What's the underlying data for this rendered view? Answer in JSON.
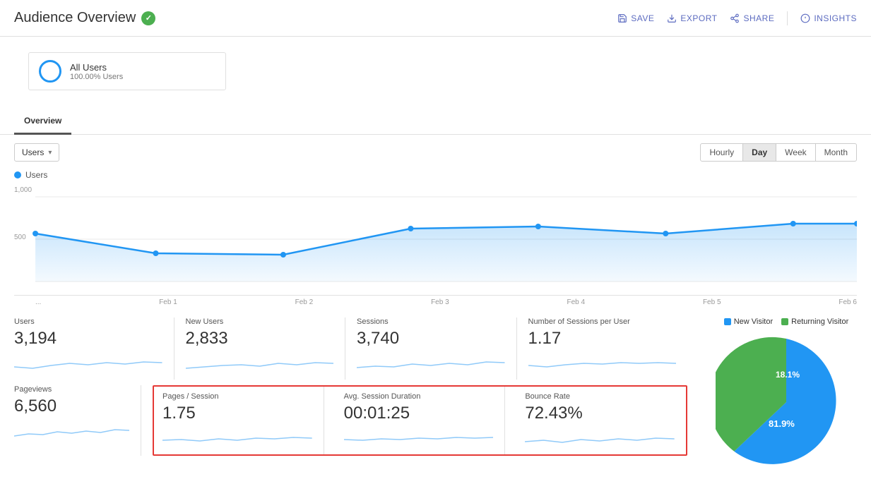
{
  "header": {
    "title": "Audience Overview",
    "actions": [
      {
        "label": "SAVE",
        "icon": "save-icon"
      },
      {
        "label": "EXPORT",
        "icon": "export-icon"
      },
      {
        "label": "SHARE",
        "icon": "share-icon"
      },
      {
        "label": "INSIGHTS",
        "icon": "insights-icon"
      }
    ]
  },
  "segment": {
    "name": "All Users",
    "sub": "100.00% Users"
  },
  "tabs": [
    {
      "label": "Overview",
      "active": true
    }
  ],
  "chart": {
    "metric_dropdown": "Users",
    "legend_label": "Users",
    "y_labels": [
      "1,000",
      "500"
    ],
    "x_labels": [
      "...",
      "Feb 1",
      "Feb 2",
      "Feb 3",
      "Feb 4",
      "Feb 5",
      "Feb 6"
    ],
    "time_buttons": [
      {
        "label": "Hourly",
        "active": false
      },
      {
        "label": "Day",
        "active": true
      },
      {
        "label": "Week",
        "active": false
      },
      {
        "label": "Month",
        "active": false
      }
    ]
  },
  "metrics": {
    "row1": [
      {
        "label": "Users",
        "value": "3,194",
        "highlight": false
      },
      {
        "label": "New Users",
        "value": "2,833",
        "highlight": false
      },
      {
        "label": "Sessions",
        "value": "3,740",
        "highlight": false
      },
      {
        "label": "Number of Sessions per User",
        "value": "1.17",
        "highlight": false
      }
    ],
    "pageviews": {
      "label": "Pageviews",
      "value": "6,560"
    },
    "row2": [
      {
        "label": "Pages / Session",
        "value": "1.75",
        "highlight": true
      },
      {
        "label": "Avg. Session Duration",
        "value": "00:01:25",
        "highlight": true
      },
      {
        "label": "Bounce Rate",
        "value": "72.43%",
        "highlight": true
      }
    ]
  },
  "pie": {
    "new_visitor_pct": 81.9,
    "returning_visitor_pct": 18.1,
    "legend": [
      {
        "label": "New Visitor",
        "color": "#2196F3"
      },
      {
        "label": "Returning Visitor",
        "color": "#4caf50"
      }
    ]
  }
}
